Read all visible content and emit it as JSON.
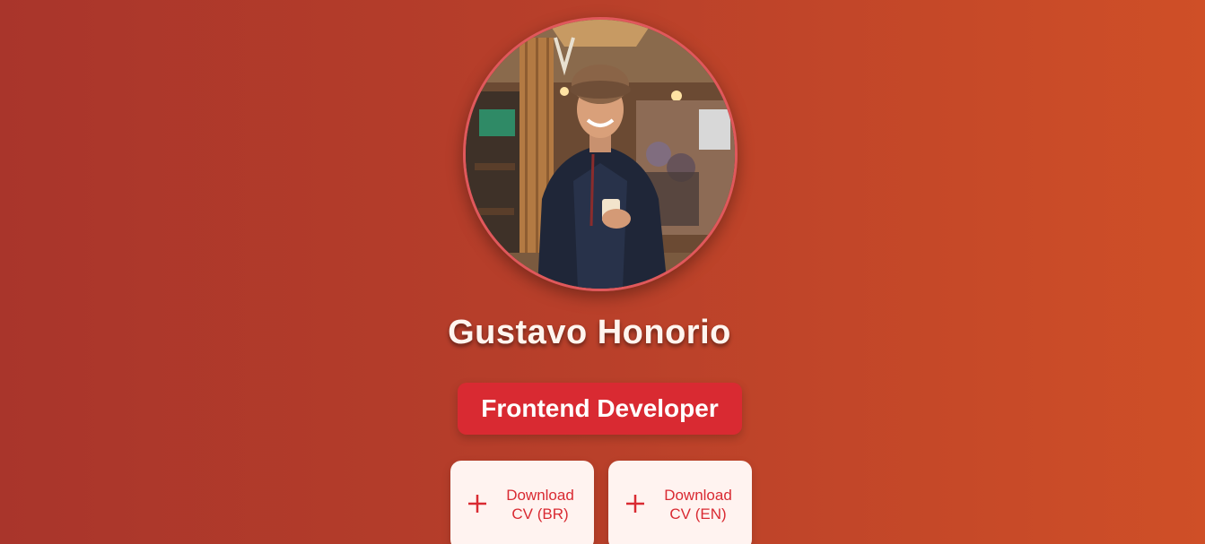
{
  "profile": {
    "name": "Gustavo Honorio",
    "role": "Frontend Developer",
    "photo_alt": "Profile photo"
  },
  "buttons": [
    {
      "line1": "Download",
      "line2": "CV (BR)",
      "icon": "plus-icon"
    },
    {
      "line1": "Download",
      "line2": "CV (EN)",
      "icon": "plus-icon"
    }
  ],
  "colors": {
    "background_start": "#a9352b",
    "background_end": "#cf4f27",
    "accent": "#d92a32",
    "button_bg": "#fff3f0",
    "avatar_border": "#e0585c"
  }
}
